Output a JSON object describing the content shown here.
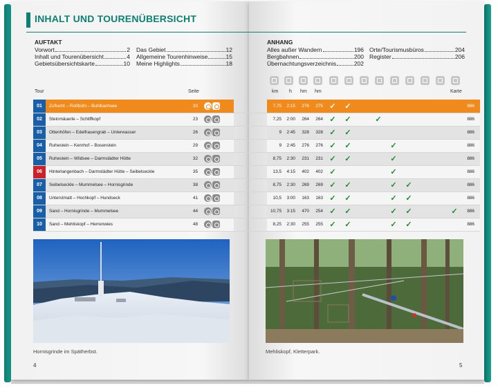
{
  "title": "INHALT UND TOURENÜBERSICHT",
  "auftakt": {
    "heading": "AUFTAKT",
    "col1": [
      {
        "label": "Vorwort",
        "page": "2"
      },
      {
        "label": "Inhalt und Tourenübersicht",
        "page": "4"
      },
      {
        "label": "Gebietsübersichtskarte",
        "page": "10"
      }
    ],
    "col2": [
      {
        "label": "Das Gebiet",
        "page": "12"
      },
      {
        "label": "Allgemeine Tourenhinweise",
        "page": "15"
      },
      {
        "label": "Meine Highlights",
        "page": "18"
      }
    ]
  },
  "anhang": {
    "heading": "ANHANG",
    "col1": [
      {
        "label": "Alles außer Wandern",
        "page": "196"
      },
      {
        "label": "Bergbahnen",
        "page": "200"
      },
      {
        "label": "Übernachtungsverzeichnis",
        "page": "202"
      }
    ],
    "col2": [
      {
        "label": "Orte/Tourismusbüros",
        "page": "204"
      },
      {
        "label": "Register",
        "page": "206"
      }
    ]
  },
  "table_headers": {
    "tour": "Tour",
    "seite": "Seite",
    "km": "km",
    "h": "h",
    "hm_up": "hm",
    "hm_down": "hm",
    "karte": "Karte"
  },
  "header_icons": [
    "parking-icon",
    "bus-icon",
    "train-icon",
    "child-icon",
    "hut-icon",
    "peak-icon",
    "lake-icon",
    "view-icon",
    "culture-icon"
  ],
  "colors": {
    "accent": "#0f7f72",
    "highlight_row": "#f08a1c",
    "tour_number_blue": "#1b5ea8",
    "tour_number_red": "#c8232c",
    "check_green": "#1a8a2e"
  },
  "tours": [
    {
      "num": "01",
      "color": "blue",
      "highlight": true,
      "name": "Zuflucht – Roßbühl – Buhlbachsee",
      "seite": "20",
      "km": "7,75",
      "h": "2:15",
      "hm_up": "276",
      "hm_down": "275",
      "checks": [
        true,
        true,
        false,
        false,
        false,
        false,
        false,
        false,
        false
      ],
      "karte": "886"
    },
    {
      "num": "02",
      "color": "blue",
      "highlight": false,
      "name": "Steinmäuerle – Schliffkopf",
      "seite": "23",
      "km": "7,25",
      "h": "2:00",
      "hm_up": "264",
      "hm_down": "264",
      "checks": [
        true,
        true,
        false,
        true,
        false,
        false,
        false,
        false,
        false
      ],
      "karte": "886"
    },
    {
      "num": "03",
      "color": "blue",
      "highlight": false,
      "name": "Ottenhöfen – Edelfrauengrab – Unterwasser",
      "seite": "26",
      "km": "9",
      "h": "2:45",
      "hm_up": "328",
      "hm_down": "328",
      "checks": [
        true,
        true,
        false,
        false,
        false,
        false,
        false,
        false,
        false
      ],
      "karte": "886"
    },
    {
      "num": "04",
      "color": "blue",
      "highlight": false,
      "name": "Ruhestein – Kernhof – Bosenstein",
      "seite": "29",
      "km": "9",
      "h": "2:45",
      "hm_up": "276",
      "hm_down": "276",
      "checks": [
        true,
        true,
        false,
        false,
        true,
        false,
        false,
        false,
        false
      ],
      "karte": "886"
    },
    {
      "num": "05",
      "color": "blue",
      "highlight": false,
      "name": "Ruhestein – Wildsee – Darmstädter Hütte",
      "seite": "32",
      "km": "8,75",
      "h": "2:30",
      "hm_up": "231",
      "hm_down": "231",
      "checks": [
        true,
        true,
        false,
        false,
        true,
        false,
        false,
        false,
        false
      ],
      "karte": "886"
    },
    {
      "num": "06",
      "color": "red",
      "highlight": false,
      "name": "Hinterlangenbach – Darmstädter Hütte – Seibelseckle",
      "seite": "35",
      "km": "13,5",
      "h": "4:15",
      "hm_up": "402",
      "hm_down": "402",
      "checks": [
        true,
        false,
        false,
        false,
        true,
        false,
        false,
        false,
        false
      ],
      "karte": "886"
    },
    {
      "num": "07",
      "color": "blue",
      "highlight": false,
      "name": "Seibelseckle – Mummelsee – Hornisgrinde",
      "seite": "38",
      "km": "8,75",
      "h": "2:30",
      "hm_up": "269",
      "hm_down": "269",
      "checks": [
        true,
        true,
        false,
        false,
        true,
        true,
        false,
        false,
        false
      ],
      "karte": "886"
    },
    {
      "num": "08",
      "color": "blue",
      "highlight": false,
      "name": "Unterstmatt – Hochkopf – Hundseck",
      "seite": "41",
      "km": "10,5",
      "h": "3:00",
      "hm_up": "163",
      "hm_down": "163",
      "checks": [
        true,
        true,
        false,
        false,
        true,
        true,
        false,
        false,
        false
      ],
      "karte": "886"
    },
    {
      "num": "09",
      "color": "blue",
      "highlight": false,
      "name": "Sand – Hornisgrinde – Mummelsee",
      "seite": "44",
      "km": "10,75",
      "h": "3:15",
      "hm_up": "470",
      "hm_down": "254",
      "checks": [
        true,
        true,
        false,
        false,
        true,
        true,
        false,
        false,
        true
      ],
      "karte": "886"
    },
    {
      "num": "10",
      "color": "blue",
      "highlight": false,
      "name": "Sand – Mehliskopf – Herrenwies",
      "seite": "48",
      "km": "8,25",
      "h": "2:30",
      "hm_up": "255",
      "hm_down": "255",
      "checks": [
        true,
        true,
        false,
        false,
        true,
        true,
        false,
        false,
        false
      ],
      "karte": "886"
    }
  ],
  "photos": {
    "left_caption": "Hornisgrinde im Spätherbst.",
    "right_caption": "Mehliskopf, Kletterpark."
  },
  "page_numbers": {
    "left": "4",
    "right": "5"
  }
}
